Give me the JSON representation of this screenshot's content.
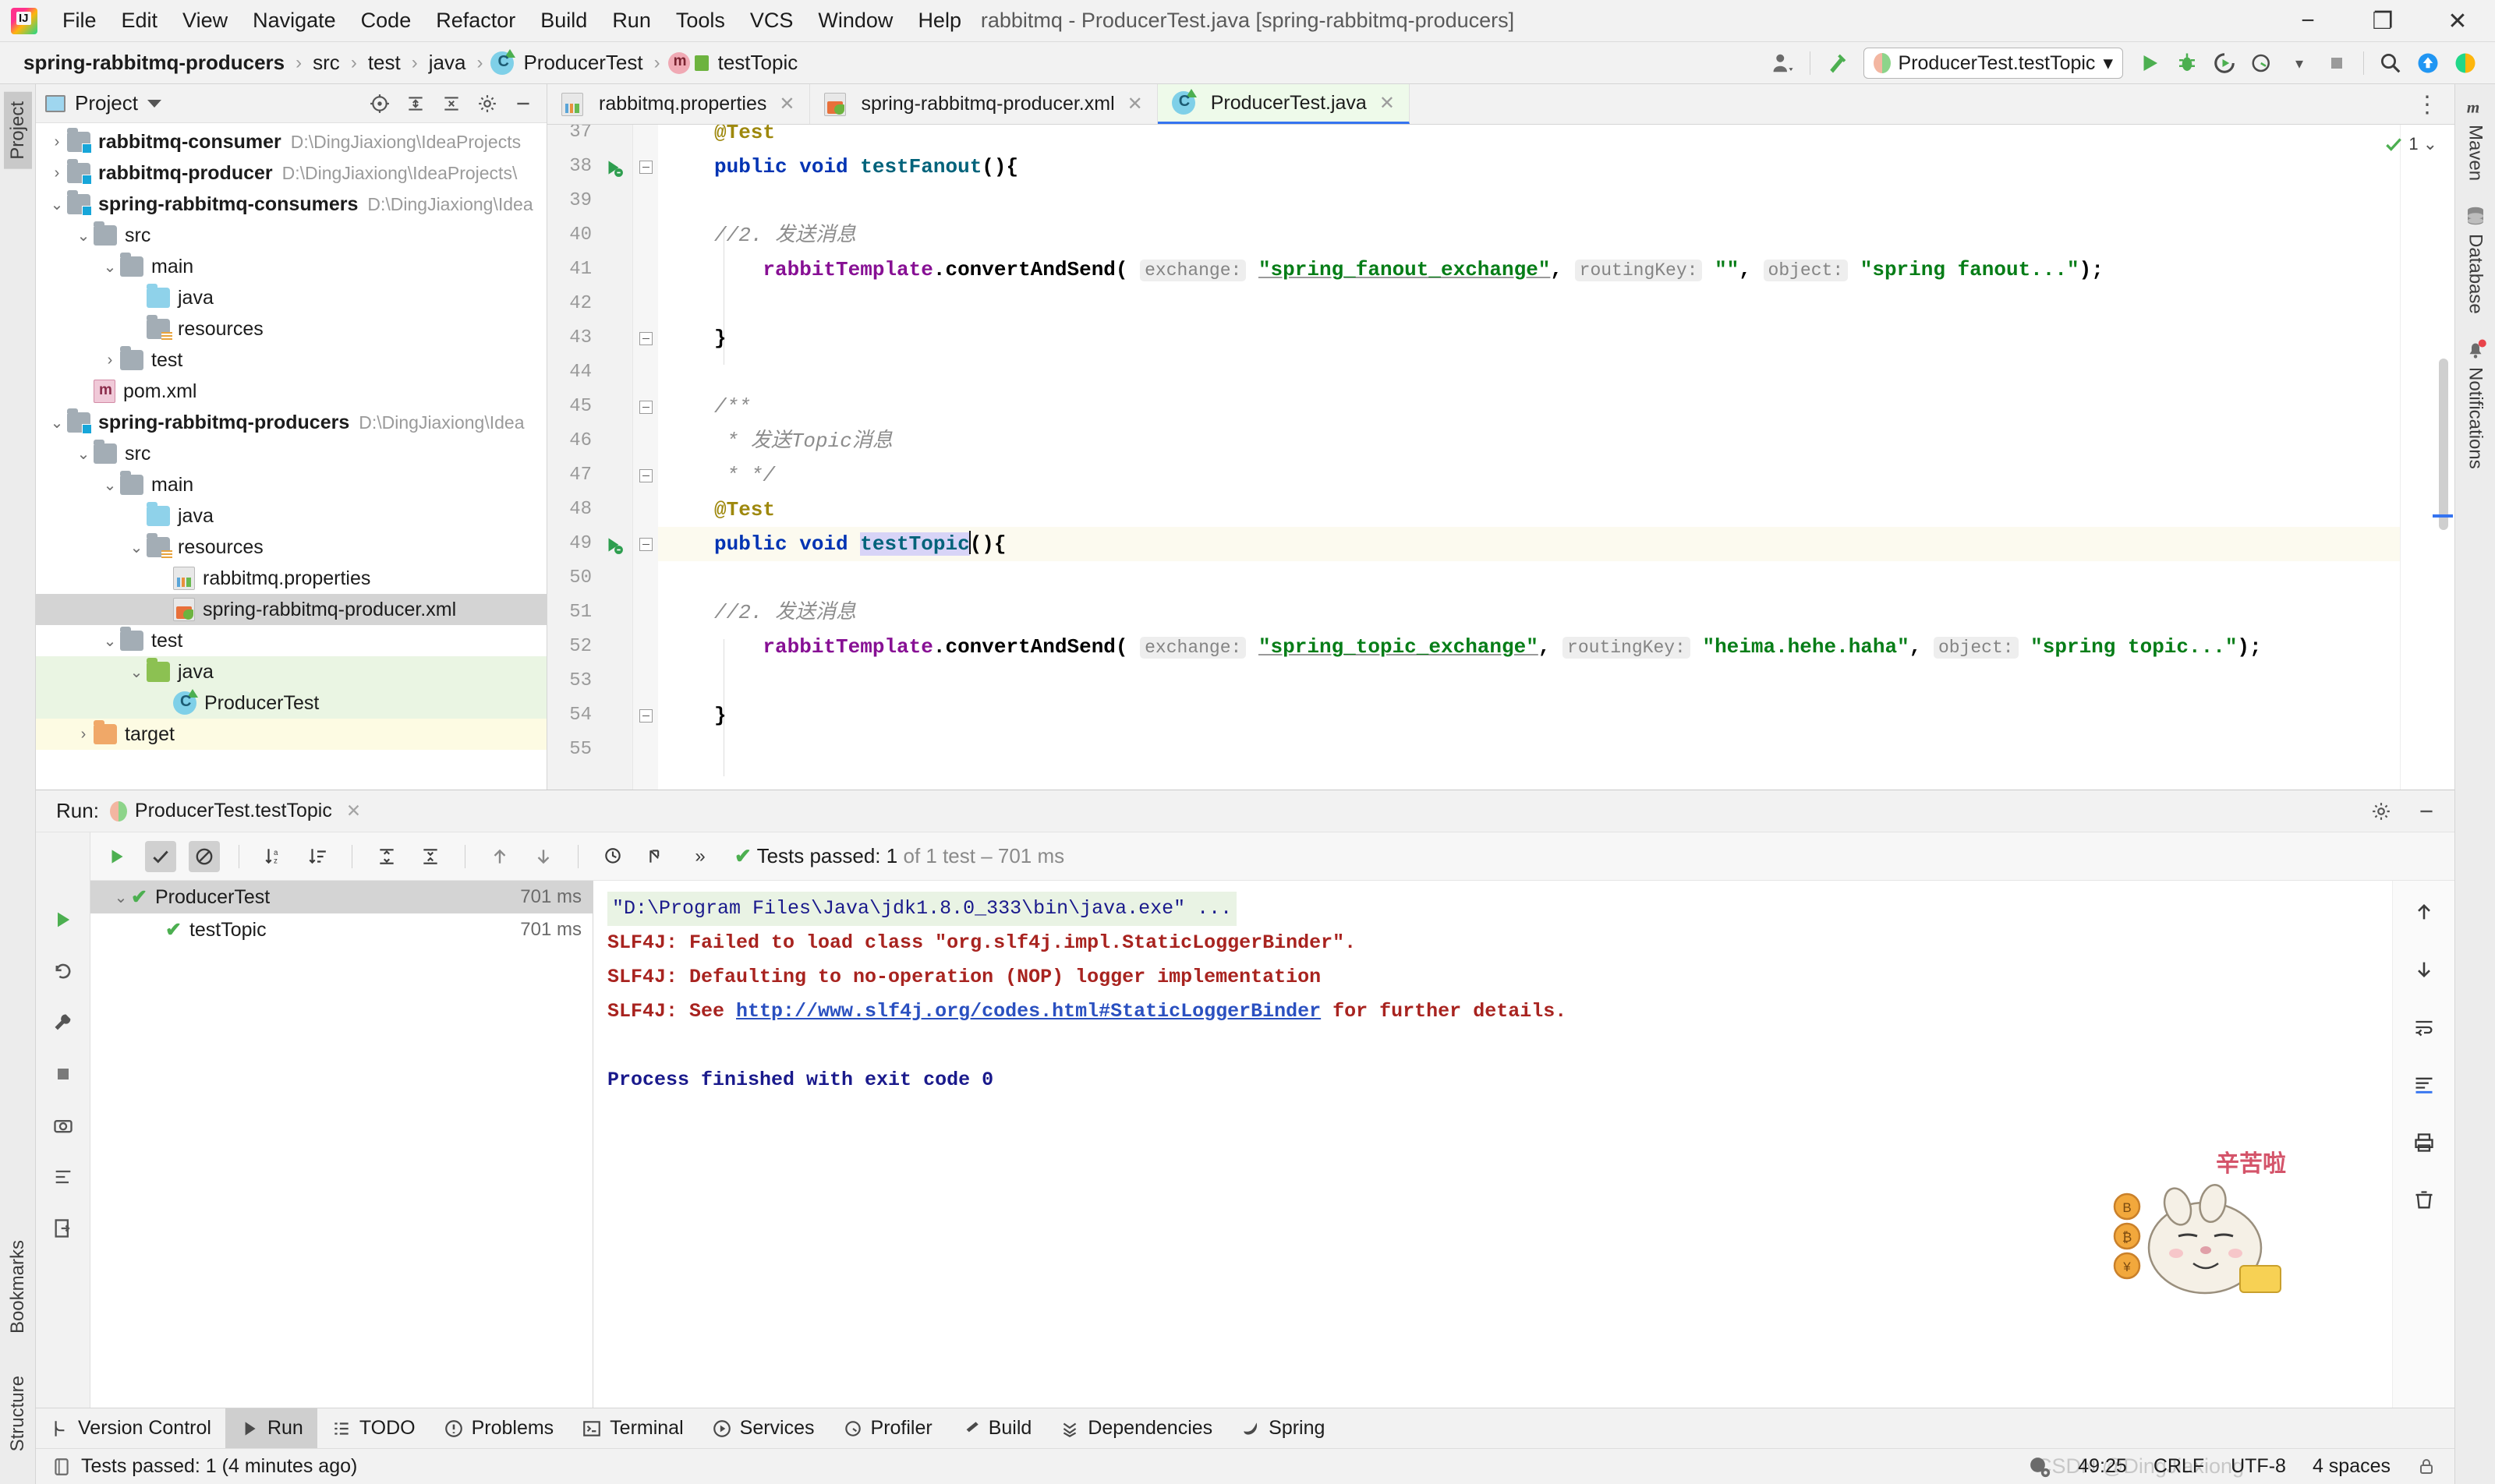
{
  "window": {
    "title": "rabbitmq - ProducerTest.java [spring-rabbitmq-producers]",
    "minimize": "−",
    "maximize": "❐",
    "close": "✕"
  },
  "menu": {
    "items": [
      "File",
      "Edit",
      "View",
      "Navigate",
      "Code",
      "Refactor",
      "Build",
      "Run",
      "Tools",
      "VCS",
      "Window",
      "Help"
    ]
  },
  "breadcrumb": {
    "items": [
      "spring-rabbitmq-producers",
      "src",
      "test",
      "java",
      "ProducerTest",
      "testTopic"
    ],
    "separator": "›"
  },
  "toolbar": {
    "run_config": "ProducerTest.testTopic",
    "run_config_caret": "▾",
    "profile_caret": "▾",
    "icons": [
      "user-icon",
      "build-hammer-icon",
      "run-icon",
      "debug-icon",
      "run-coverage-icon",
      "profile-icon",
      "stop-icon",
      "search-icon",
      "update-icon",
      "idea-icon"
    ]
  },
  "left_strip": {
    "project_tab": "Project",
    "bookmarks_tab": "Bookmarks",
    "structure_tab": "Structure"
  },
  "right_strip": {
    "items": [
      {
        "label": "Maven",
        "icon": "maven-icon"
      },
      {
        "label": "Database",
        "icon": "database-icon"
      },
      {
        "label": "Notifications",
        "icon": "bell-icon"
      }
    ]
  },
  "project_panel": {
    "title": "Project",
    "caret": "▾",
    "tree": [
      {
        "indent": 0,
        "arrow": "›",
        "icon": "module-folder",
        "label": "rabbitmq-consumer",
        "bold": true,
        "path": "D:\\DingJiaxiong\\IdeaProjects",
        "state": "normal"
      },
      {
        "indent": 0,
        "arrow": "›",
        "icon": "module-folder",
        "label": "rabbitmq-producer",
        "bold": true,
        "path": "D:\\DingJiaxiong\\IdeaProjects\\",
        "state": "normal"
      },
      {
        "indent": 0,
        "arrow": "⌄",
        "icon": "module-folder",
        "label": "spring-rabbitmq-consumers",
        "bold": true,
        "path": "D:\\DingJiaxiong\\Idea",
        "state": "normal"
      },
      {
        "indent": 1,
        "arrow": "⌄",
        "icon": "folder",
        "label": "src",
        "bold": false,
        "path": "",
        "state": "normal"
      },
      {
        "indent": 2,
        "arrow": "⌄",
        "icon": "folder",
        "label": "main",
        "bold": false,
        "path": "",
        "state": "normal"
      },
      {
        "indent": 3,
        "arrow": "",
        "icon": "folder-blue",
        "label": "java",
        "bold": false,
        "path": "",
        "state": "normal"
      },
      {
        "indent": 3,
        "arrow": "",
        "icon": "folder-resources",
        "label": "resources",
        "bold": false,
        "path": "",
        "state": "normal"
      },
      {
        "indent": 2,
        "arrow": "›",
        "icon": "folder",
        "label": "test",
        "bold": false,
        "path": "",
        "state": "normal"
      },
      {
        "indent": 1,
        "arrow": "",
        "icon": "maven-file",
        "label": "pom.xml",
        "bold": false,
        "path": "",
        "state": "normal"
      },
      {
        "indent": 0,
        "arrow": "⌄",
        "icon": "module-folder",
        "label": "spring-rabbitmq-producers",
        "bold": true,
        "path": "D:\\DingJiaxiong\\Idea",
        "state": "normal"
      },
      {
        "indent": 1,
        "arrow": "⌄",
        "icon": "folder",
        "label": "src",
        "bold": false,
        "path": "",
        "state": "normal"
      },
      {
        "indent": 2,
        "arrow": "⌄",
        "icon": "folder",
        "label": "main",
        "bold": false,
        "path": "",
        "state": "normal"
      },
      {
        "indent": 3,
        "arrow": "",
        "icon": "folder-blue",
        "label": "java",
        "bold": false,
        "path": "",
        "state": "normal"
      },
      {
        "indent": 3,
        "arrow": "⌄",
        "icon": "folder-resources",
        "label": "resources",
        "bold": false,
        "path": "",
        "state": "normal"
      },
      {
        "indent": 4,
        "arrow": "",
        "icon": "properties-file",
        "label": "rabbitmq.properties",
        "bold": false,
        "path": "",
        "state": "normal"
      },
      {
        "indent": 4,
        "arrow": "",
        "icon": "spring-xml-file",
        "label": "spring-rabbitmq-producer.xml",
        "bold": false,
        "path": "",
        "state": "selected"
      },
      {
        "indent": 2,
        "arrow": "⌄",
        "icon": "folder",
        "label": "test",
        "bold": false,
        "path": "",
        "state": "normal"
      },
      {
        "indent": 3,
        "arrow": "⌄",
        "icon": "folder-green",
        "label": "java",
        "bold": false,
        "path": "",
        "state": "green"
      },
      {
        "indent": 4,
        "arrow": "",
        "icon": "java-class",
        "label": "ProducerTest",
        "bold": false,
        "path": "",
        "state": "green"
      },
      {
        "indent": 1,
        "arrow": "›",
        "icon": "folder-orange",
        "label": "target",
        "bold": false,
        "path": "",
        "state": "yellow"
      }
    ]
  },
  "editor_tabs": [
    {
      "label": "rabbitmq.properties",
      "icon": "properties-file",
      "active": false,
      "close": "✕"
    },
    {
      "label": "spring-rabbitmq-producer.xml",
      "icon": "spring-xml-file",
      "active": false,
      "close": "✕"
    },
    {
      "label": "ProducerTest.java",
      "icon": "java-class",
      "active": true,
      "close": "✕"
    }
  ],
  "editor": {
    "inspection_count": "1",
    "lines": [
      {
        "num": "37",
        "text": "@Test",
        "type": "anno-partial"
      },
      {
        "num": "38",
        "text": "public void testFanout(){",
        "type": "method-fanout",
        "gutter": "run-test-icon",
        "fold": true
      },
      {
        "num": "39",
        "text": "",
        "type": "blank"
      },
      {
        "num": "40",
        "text": "//2. 发送消息",
        "type": "comment"
      },
      {
        "num": "41",
        "text": "rabbitTemplate.convertAndSend( exchange: \"spring_fanout_exchange\", routingKey: \"\", object: \"spring fanout...\");",
        "type": "call-fanout"
      },
      {
        "num": "42",
        "text": "",
        "type": "blank"
      },
      {
        "num": "43",
        "text": "}",
        "type": "brace",
        "fold": true
      },
      {
        "num": "44",
        "text": "",
        "type": "blank"
      },
      {
        "num": "45",
        "text": "/**",
        "type": "comment",
        "fold": true
      },
      {
        "num": "46",
        "text": " * 发送Topic消息",
        "type": "comment"
      },
      {
        "num": "47",
        "text": " * */",
        "type": "comment",
        "fold": true
      },
      {
        "num": "48",
        "text": "@Test",
        "type": "anno"
      },
      {
        "num": "49",
        "text": "public void testTopic(){",
        "type": "method-topic",
        "gutter": "run-test-icon",
        "fold": true,
        "highlight": true
      },
      {
        "num": "50",
        "text": "",
        "type": "blank"
      },
      {
        "num": "51",
        "text": "//2. 发送消息",
        "type": "comment"
      },
      {
        "num": "52",
        "text": "rabbitTemplate.convertAndSend( exchange: \"spring_topic_exchange\", routingKey: \"heima.hehe.haha\", object: \"spring topic...\");",
        "type": "call-topic"
      },
      {
        "num": "53",
        "text": "",
        "type": "blank"
      },
      {
        "num": "54",
        "text": "}",
        "type": "brace",
        "fold": true
      },
      {
        "num": "55",
        "text": "",
        "type": "blank"
      }
    ],
    "tokens": {
      "kw_public": "public",
      "kw_void": "void",
      "method_fanout": "testFanout",
      "method_topic": "testTopic",
      "parens_open_brace": "(){",
      "annotation": "@Test",
      "comment_send": "//2. 发送消息",
      "comment_block_open": "/**",
      "comment_block_mid": " * 发送Topic消息",
      "comment_block_close": " * */",
      "field_template": "rabbitTemplate",
      "method_convert": ".convertAndSend(",
      "hint_exchange": "exchange:",
      "hint_routingkey": "routingKey:",
      "hint_object": "object:",
      "str_fanout_exchange": "\"spring_fanout_exchange\"",
      "str_empty": "\"\"",
      "str_fanout_msg": "\"spring fanout...\"",
      "str_topic_exchange": "\"spring_topic_exchange\"",
      "str_routing_key": "\"heima.hehe.haha\"",
      "str_topic_msg": "\"spring topic...\"",
      "comma": ",",
      "close": ");",
      "brace_close": "}"
    }
  },
  "run_panel": {
    "label": "Run:",
    "tab_title": "ProducerTest.testTopic",
    "tab_close": "✕",
    "settings_icon": "gear-icon",
    "minimize_icon": "minimize-icon",
    "toolbar_icons": [
      "rerun-icon",
      "show-passed-icon",
      "hide-ignored-icon",
      "sort-alpha-icon",
      "sort-duration-icon",
      "expand-all-icon",
      "collapse-all-icon",
      "prev-failed-icon",
      "next-failed-icon",
      "history-icon",
      "export-icon",
      "more-icon"
    ],
    "status": {
      "check": "✔",
      "passed_label": "Tests passed:",
      "passed_count": "1",
      "detail": "of 1 test – 701 ms"
    },
    "tests": [
      {
        "name": "ProducerTest",
        "time": "701 ms",
        "arrow": "⌄",
        "check": "✔",
        "selected": true,
        "indent": 0
      },
      {
        "name": "testTopic",
        "time": "701 ms",
        "arrow": "",
        "check": "✔",
        "selected": false,
        "indent": 1
      }
    ],
    "console": {
      "command": "\"D:\\Program Files\\Java\\jdk1.8.0_333\\bin\\java.exe\" ...",
      "lines": [
        "SLF4J: Failed to load class \"org.slf4j.impl.StaticLoggerBinder\".",
        "SLF4J: Defaulting to no-operation (NOP) logger implementation"
      ],
      "link_line_prefix": "SLF4J: See ",
      "link_text": "http://www.slf4j.org/codes.html#StaticLoggerBinder",
      "link_line_suffix": " for further details.",
      "exit_line": "Process finished with exit code 0"
    },
    "side_icons": [
      "scroll-up-icon",
      "scroll-down-icon",
      "soft-wrap-icon",
      "scroll-to-end-icon",
      "print-icon",
      "clear-all-icon"
    ],
    "left_icons": [
      "rerun-icon",
      "rerun-failed-icon",
      "settings-wrench-icon",
      "stop-icon",
      "screenshot-icon",
      "dump-threads-icon",
      "export-icon"
    ]
  },
  "mascot": {
    "text": "辛苦啦",
    "coins": [
      "B",
      "₿",
      "¥"
    ]
  },
  "tool_windows": {
    "items": [
      {
        "label": "Version Control",
        "icon": "branch-icon",
        "active": false
      },
      {
        "label": "Run",
        "icon": "run-icon",
        "active": true
      },
      {
        "label": "TODO",
        "icon": "todo-icon",
        "active": false
      },
      {
        "label": "Problems",
        "icon": "problems-icon",
        "active": false
      },
      {
        "label": "Terminal",
        "icon": "terminal-icon",
        "active": false
      },
      {
        "label": "Services",
        "icon": "services-icon",
        "active": false
      },
      {
        "label": "Profiler",
        "icon": "profiler-icon",
        "active": false
      },
      {
        "label": "Build",
        "icon": "build-icon",
        "active": false
      },
      {
        "label": "Dependencies",
        "icon": "dependencies-icon",
        "active": false
      },
      {
        "label": "Spring",
        "icon": "spring-icon",
        "active": false
      }
    ]
  },
  "status_bar": {
    "message": "Tests passed: 1 (4 minutes ago)",
    "message_icon": "event-log-icon",
    "caret_position": "49:25",
    "line_separator": "CRLF",
    "encoding": "UTF-8",
    "indent": "4 spaces",
    "watermark": "CSDN @DingJiaxiong",
    "inspection_icon": "inspection-face-icon",
    "lock_icon": "lock-icon"
  },
  "colors": {
    "accent_blue": "#3574f0",
    "keyword": "#0033b3",
    "string": "#067d17",
    "annotation": "#9e880d",
    "field": "#871094",
    "method": "#00627a",
    "error_red": "#a8231f",
    "console_blue": "#1a1a8c",
    "success_green": "#4caf50",
    "selection": "#d4d4d4",
    "highlight_line": "#fcfaef"
  }
}
